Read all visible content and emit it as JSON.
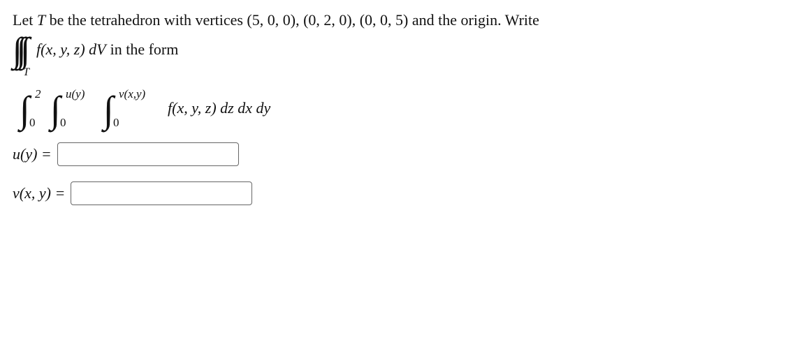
{
  "problem": {
    "intro_prefix": "Let ",
    "T": "T",
    "intro_mid": " be the tetrahedron with vertices ",
    "vertices": "(5, 0, 0), (0, 2, 0), (0, 0, 5)",
    "intro_suffix": " and the origin. Write",
    "triple_integrand": "f(x, y, z) dV",
    "trailing": " in the form",
    "outer_upper": "2",
    "outer_lower": "0",
    "mid_upper": "u(y)",
    "mid_lower": "0",
    "inner_upper": "v(x,y)",
    "inner_lower": "0",
    "iterated_integrand": "f(x, y, z) dz dx dy"
  },
  "answers": {
    "u_label": "u(y) = ",
    "u_value": "",
    "v_label": "v(x, y) = ",
    "v_value": ""
  }
}
